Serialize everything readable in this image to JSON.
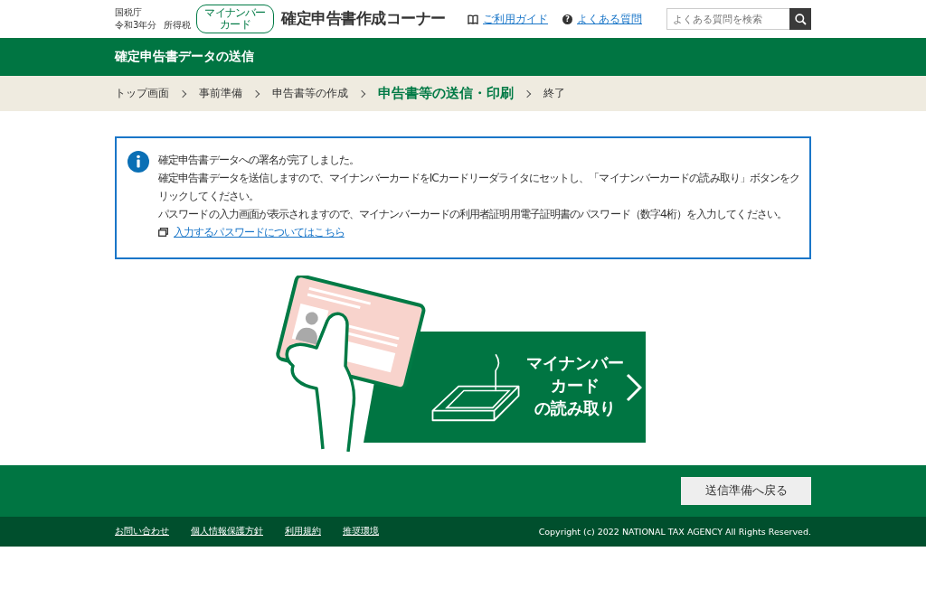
{
  "header": {
    "agency": "国税庁",
    "year": "令和3年分",
    "tax": "所得税",
    "badge": [
      "マイナンバー",
      "カード"
    ],
    "title": "確定申告書作成コーナー",
    "guide_link": "ご利用ガイド",
    "faq_icon": "?",
    "faq_link": "よくある質問",
    "search": {
      "placeholder": "よくある質問を検索"
    }
  },
  "page_title": "確定申告書データの送信",
  "breadcrumb": [
    {
      "label": "トップ画面",
      "selected": false
    },
    {
      "label": "事前準備",
      "selected": false
    },
    {
      "label": "申告書等の作成",
      "selected": false
    },
    {
      "label": "申告書等の送信・印刷",
      "selected": true
    },
    {
      "label": "終了",
      "selected": false
    }
  ],
  "info": {
    "messages": [
      "確定申告書データへの署名が完了しました。",
      "確定申告書データを送信しますので、マイナンバーカードをICカードリーダライタにセットし、「マイナンバーカードの読み取り」ボタンをクリックしてください。",
      "パスワードの入力画面が表示されますので、マイナンバーカードの利用者証明用電子証明書のパスワード（数字4桁）を入力してください。"
    ],
    "link": "入力するパスワードについてはこちら"
  },
  "read_button": [
    "マイナンバー",
    "カード",
    "の読み取り"
  ],
  "back_button": "送信準備へ戻る",
  "footer": {
    "links": [
      "お問い合わせ",
      "個人情報保護方針",
      "利用規約",
      "推奨環境"
    ],
    "copyright": "Copyright (c) 2022 NATIONAL TAX AGENCY All Rights Reserved."
  }
}
